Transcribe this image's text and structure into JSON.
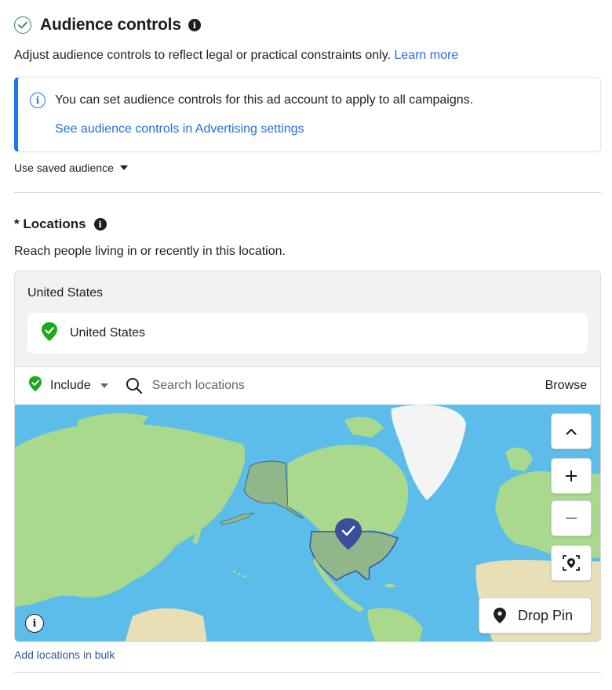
{
  "audience_controls": {
    "title": "Audience controls",
    "description": "Adjust audience controls to reflect legal or practical constraints only.",
    "learn_more": "Learn more"
  },
  "notice": {
    "text": "You can set audience controls for this ad account to apply to all campaigns.",
    "link": "See audience controls in Advertising settings"
  },
  "saved_audience": {
    "label": "Use saved audience"
  },
  "locations": {
    "title": "* Locations",
    "description": "Reach people living in or recently in this location.",
    "group_label": "United States",
    "selected": [
      "United States"
    ],
    "include_label": "Include",
    "search_placeholder": "Search locations",
    "browse_label": "Browse"
  },
  "map": {
    "drop_pin_label": "Drop Pin",
    "controls": [
      "collapse-map",
      "zoom-in",
      "zoom-out",
      "locate-me"
    ]
  },
  "bulk": {
    "label": "Add locations in bulk"
  },
  "colors": {
    "accent_blue": "#1877f2",
    "link_blue": "#216fdb",
    "include_green": "#1aa91a",
    "ocean": "#5cbdea",
    "land": "#a9d98d",
    "selected_region": "#8fb78a",
    "pin": "#3b4e9a"
  },
  "icons": {
    "status": "check-circle-icon",
    "info": "info-icon",
    "include": "shield-check-icon",
    "search": "search-icon",
    "pin": "map-pin-icon"
  }
}
